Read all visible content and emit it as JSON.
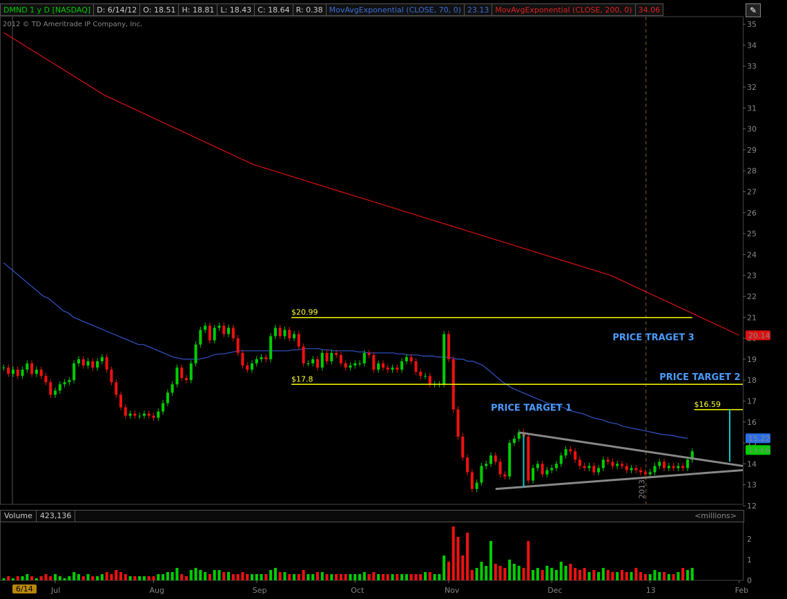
{
  "header": {
    "symbol": "DMND 1 y D [NASDAQ]",
    "date": "D: 6/14/12",
    "open": "O: 18.51",
    "high": "H: 18.81",
    "low": "L: 18.43",
    "close": "C: 18.64",
    "range": "R: 0.38",
    "ma70_label": "MovAvgExponential (CLOSE, 70, 0)",
    "ma70_value": "23.13",
    "ma200_label": "MovAvgExponential (CLOSE, 200, 0)",
    "ma200_value": "34.06"
  },
  "copyright": "2012 © TD Ameritrade IP Company, Inc.",
  "volume_panel": {
    "label": "Volume",
    "value": "423,136",
    "units": "<millions>"
  },
  "date_badge": "6/14",
  "colors": {
    "up": "#00cc00",
    "down": "#ee1111",
    "ma70": "#3355cc",
    "ma200": "#dd1111",
    "levels": "#ffff00",
    "target": "#4a9cff",
    "triangle": "#888888",
    "measure": "#00cccc"
  },
  "chart_data": {
    "type": "candlestick",
    "title": "",
    "y_ticks": [
      12,
      13,
      14,
      15,
      16,
      17,
      18,
      19,
      20,
      21,
      22,
      23,
      24,
      25,
      26,
      27,
      28,
      29,
      30,
      31,
      32,
      33,
      34,
      35
    ],
    "ylim": [
      12,
      35.3
    ],
    "x_tick_labels": [
      "Jul",
      "Aug",
      "Sep",
      "Oct",
      "Nov",
      "Dec",
      "13",
      "Feb"
    ],
    "x_tick_index": [
      11,
      32,
      54,
      75,
      95,
      117,
      138,
      157
    ],
    "n_bars": 158,
    "closes": [
      18.6,
      18.3,
      18.5,
      18.2,
      18.5,
      18.8,
      18.3,
      18.5,
      18.2,
      17.9,
      17.3,
      17.5,
      17.8,
      17.9,
      18.0,
      18.8,
      19.0,
      18.7,
      18.9,
      18.6,
      18.9,
      19.1,
      18.5,
      17.9,
      17.3,
      16.7,
      16.3,
      16.4,
      16.3,
      16.3,
      16.4,
      16.3,
      16.2,
      16.5,
      16.9,
      17.4,
      17.8,
      18.6,
      18.1,
      18.0,
      18.8,
      19.7,
      20.4,
      20.6,
      19.9,
      20.5,
      20.6,
      20.2,
      20.5,
      20.0,
      19.3,
      18.7,
      18.5,
      18.8,
      19.0,
      19.1,
      19.0,
      20.1,
      20.5,
      20.1,
      20.4,
      20.0,
      20.2,
      19.6,
      18.8,
      18.8,
      19.0,
      18.6,
      19.3,
      18.9,
      19.3,
      19.2,
      18.8,
      18.6,
      18.7,
      18.8,
      18.8,
      19.3,
      19.2,
      18.5,
      18.8,
      18.6,
      18.5,
      18.6,
      18.5,
      18.9,
      19.1,
      18.9,
      18.4,
      18.2,
      18.2,
      17.8,
      17.8,
      17.8,
      20.2,
      19.0,
      16.6,
      15.3,
      14.3,
      13.6,
      12.8,
      13.1,
      13.9,
      14.0,
      14.4,
      14.1,
      13.5,
      13.4,
      15.0,
      15.2,
      15.5,
      15.3,
      13.2,
      13.8,
      14.0,
      13.5,
      13.7,
      13.8,
      14.0,
      14.4,
      14.7,
      14.6,
      14.2,
      13.9,
      13.8,
      13.9,
      13.6,
      13.8,
      14.2,
      14.1,
      13.9,
      14.0,
      13.9,
      13.7,
      13.8,
      13.7,
      13.6,
      13.5,
      13.6,
      13.9,
      14.1,
      13.8,
      13.9,
      13.8,
      13.9,
      13.8,
      14.2,
      14.6
    ],
    "volumes": [
      0.1,
      0.2,
      0.1,
      0.2,
      0.2,
      0.3,
      0.2,
      0.1,
      0.2,
      0.3,
      0.2,
      0.3,
      0.2,
      0.1,
      0.2,
      0.4,
      0.3,
      0.2,
      0.3,
      0.2,
      0.2,
      0.3,
      0.4,
      0.3,
      0.5,
      0.4,
      0.3,
      0.2,
      0.2,
      0.2,
      0.2,
      0.2,
      0.2,
      0.3,
      0.3,
      0.4,
      0.4,
      0.6,
      0.3,
      0.2,
      0.5,
      0.6,
      0.5,
      0.4,
      0.3,
      0.5,
      0.5,
      0.4,
      0.4,
      0.3,
      0.3,
      0.4,
      0.3,
      0.3,
      0.3,
      0.3,
      0.3,
      0.5,
      0.6,
      0.4,
      0.4,
      0.3,
      0.3,
      0.3,
      0.5,
      0.3,
      0.3,
      0.4,
      0.4,
      0.3,
      0.3,
      0.3,
      0.3,
      0.3,
      0.3,
      0.3,
      0.3,
      0.4,
      0.3,
      0.4,
      0.3,
      0.3,
      0.3,
      0.3,
      0.3,
      0.3,
      0.3,
      0.3,
      0.3,
      0.3,
      0.4,
      0.4,
      0.3,
      0.3,
      1.2,
      0.9,
      2.6,
      2.1,
      1.2,
      2.3,
      0.5,
      0.6,
      0.9,
      0.7,
      1.9,
      0.8,
      0.7,
      0.6,
      1.0,
      0.8,
      0.7,
      0.6,
      1.9,
      0.5,
      0.6,
      0.5,
      0.7,
      0.6,
      0.5,
      0.9,
      0.7,
      0.8,
      0.6,
      0.5,
      0.6,
      0.4,
      0.5,
      0.4,
      0.6,
      0.5,
      0.4,
      0.4,
      0.5,
      0.4,
      0.4,
      0.6,
      0.4,
      0.3,
      0.3,
      0.5,
      0.4,
      0.4,
      0.3,
      0.3,
      0.4,
      0.6,
      0.5,
      0.6
    ],
    "ma70": [
      23.6,
      23.4,
      23.2,
      23.0,
      22.8,
      22.6,
      22.4,
      22.2,
      22.0,
      21.9,
      21.7,
      21.5,
      21.3,
      21.2,
      21.0,
      20.9,
      20.8,
      20.7,
      20.6,
      20.5,
      20.4,
      20.3,
      20.2,
      20.1,
      20.0,
      19.9,
      19.8,
      19.7,
      19.7,
      19.6,
      19.5,
      19.4,
      19.3,
      19.2,
      19.1,
      19.05,
      19.0,
      19.0,
      19.0,
      19.0,
      19.05,
      19.1,
      19.2,
      19.25,
      19.25,
      19.3,
      19.35,
      19.4,
      19.4,
      19.4,
      19.4,
      19.4,
      19.4,
      19.4,
      19.4,
      19.4,
      19.4,
      19.4,
      19.45,
      19.45,
      19.5,
      19.5,
      19.5,
      19.5,
      19.45,
      19.45,
      19.4,
      19.4,
      19.4,
      19.4,
      19.4,
      19.35,
      19.35,
      19.3,
      19.3,
      19.3,
      19.3,
      19.3,
      19.3,
      19.25,
      19.25,
      19.2,
      19.2,
      19.2,
      19.15,
      19.15,
      19.15,
      19.1,
      19.1,
      19.1,
      19.05,
      19.0,
      19.0,
      18.9,
      18.9,
      18.8,
      18.7,
      18.5,
      18.3,
      18.1,
      17.9,
      17.75,
      17.6,
      17.5,
      17.4,
      17.3,
      17.2,
      17.1,
      17.0,
      16.9,
      16.85,
      16.8,
      16.7,
      16.6,
      16.5,
      16.45,
      16.4,
      16.3,
      16.2,
      16.15,
      16.1,
      16.0,
      15.95,
      15.9,
      15.8,
      15.75,
      15.7,
      15.65,
      15.6,
      15.55,
      15.5,
      15.45,
      15.4,
      15.38,
      15.35,
      15.3,
      15.25,
      15.22
    ],
    "ma200": [
      34.6,
      34.4,
      34.2,
      34.0,
      33.8,
      33.6,
      33.4,
      33.2,
      33.0,
      32.8,
      32.6,
      32.4,
      32.2,
      32.0,
      31.8,
      31.6,
      31.45,
      31.3,
      31.15,
      31.0,
      30.85,
      30.7,
      30.55,
      30.4,
      30.25,
      30.1,
      29.95,
      29.8,
      29.65,
      29.5,
      29.35,
      29.2,
      29.05,
      28.9,
      28.75,
      28.6,
      28.45,
      28.3,
      28.2,
      28.1,
      28.0,
      27.9,
      27.8,
      27.7,
      27.6,
      27.5,
      27.4,
      27.3,
      27.2,
      27.1,
      27.0,
      26.9,
      26.8,
      26.7,
      26.6,
      26.5,
      26.4,
      26.3,
      26.2,
      26.1,
      26.0,
      25.9,
      25.8,
      25.7,
      25.6,
      25.5,
      25.4,
      25.3,
      25.2,
      25.1,
      25.0,
      24.9,
      24.8,
      24.7,
      24.6,
      24.5,
      24.4,
      24.3,
      24.2,
      24.1,
      24.0,
      23.9,
      23.8,
      23.7,
      23.6,
      23.5,
      23.4,
      23.3,
      23.2,
      23.1,
      23.0,
      22.85,
      22.7,
      22.55,
      22.4,
      22.25,
      22.1,
      21.95,
      21.8,
      21.65,
      21.5,
      21.35,
      21.2,
      21.05,
      20.9,
      20.75,
      20.6,
      20.45,
      20.3,
      20.14
    ],
    "levels": [
      {
        "label": "$20.99",
        "value": 20.99
      },
      {
        "label": "$17.8",
        "value": 17.8
      },
      {
        "label": "$16.59",
        "value": 16.59
      }
    ],
    "targets": [
      "PRICE TRAGET 3",
      "PRICE TARGET 2",
      "PRICE TARGET 1"
    ],
    "price_badges": [
      {
        "label": "20.14",
        "value": 20.14,
        "color": "#dd1111"
      },
      {
        "label": "15.22",
        "value": 15.22,
        "color": "#3355cc"
      },
      {
        "label": "14.66",
        "value": 14.66,
        "color": "#00cc00"
      }
    ],
    "vol_ticks": [
      0,
      1,
      2
    ],
    "vol_ylim": [
      0,
      2.8
    ],
    "year_marker": "2013"
  }
}
